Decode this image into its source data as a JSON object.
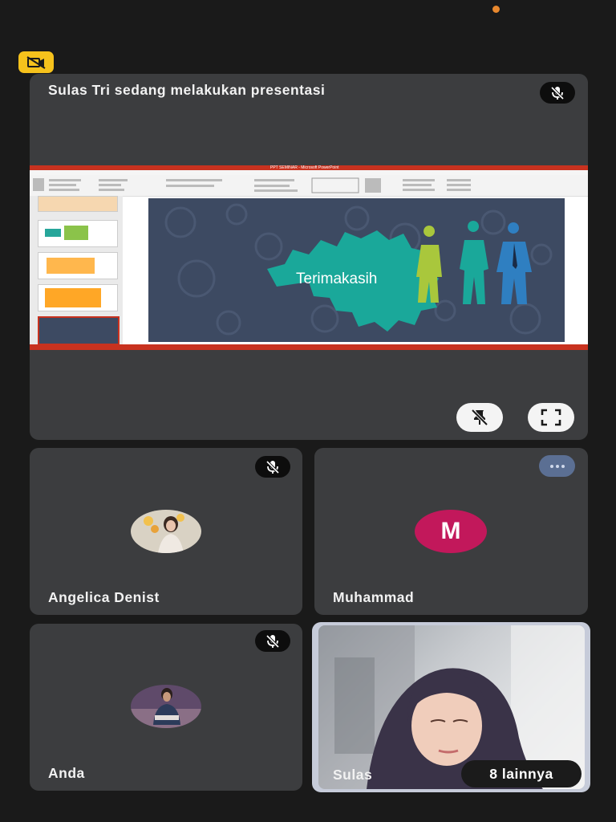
{
  "presentation": {
    "title": "Sulas Tri sedang melakukan presentasi",
    "slide_text": "Terimakasih",
    "window_title": "PPT SEMINAR - Microsoft PowerPoint"
  },
  "participants": [
    {
      "name": "Angelica Denist",
      "muted": true
    },
    {
      "name": "Muhammad",
      "initial": "M",
      "muted": false
    },
    {
      "name": "Anda",
      "muted": true
    },
    {
      "name": "Sulas",
      "muted": false
    }
  ],
  "others_label": "8 lainnya",
  "colors": {
    "tile": "#3c3d3f",
    "camera_badge": "#f6c21c",
    "avatar_m": "#c2185b",
    "active_border": "#c6cbd9",
    "slide_bg": "#3d4a62",
    "gear": "#1aa89a"
  },
  "icons": {
    "camera_badge": "camera-off-icon",
    "mic": "mic-off-icon",
    "unpin": "unpin-icon",
    "fullscreen": "fullscreen-icon",
    "more": "more-options-icon"
  }
}
